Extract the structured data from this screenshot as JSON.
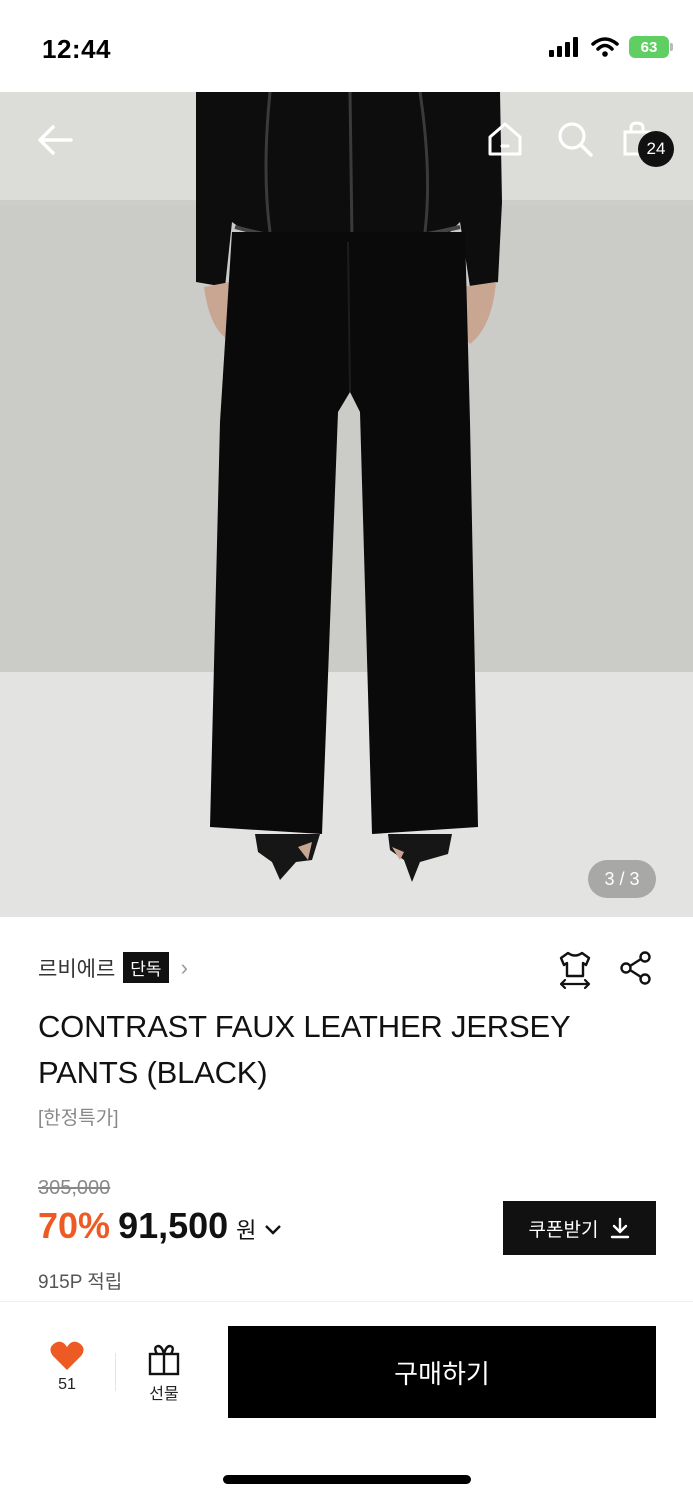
{
  "status_bar": {
    "time": "12:44",
    "battery_level": "63",
    "icons": [
      "signal-icon",
      "wifi-icon",
      "battery-icon"
    ]
  },
  "header": {
    "icons": [
      "back-arrow-icon",
      "home-icon",
      "search-icon",
      "shopping-bag-icon"
    ],
    "cart_count": "24"
  },
  "gallery": {
    "counter": "3 / 3"
  },
  "product": {
    "brand": "르비에르",
    "exclusive_badge": "단독",
    "title": "CONTRAST FAUX LEATHER JERSEY PANTS (BLACK)",
    "promo_tag": "[한정특가]",
    "original_price": "305,000",
    "discount": "70%",
    "sale_price": "91,500",
    "currency": "원",
    "points": "915P 적립"
  },
  "actions": {
    "coupon_label": "쿠폰받기",
    "icons": [
      "size-guide-icon",
      "share-icon"
    ]
  },
  "bottom_bar": {
    "like_count": "51",
    "gift_label": "선물",
    "buy_label": "구매하기"
  },
  "colors": {
    "accent": "#ee5a24",
    "primary": "#000000",
    "badge_bg": "#111111",
    "battery": "#5fcf63"
  }
}
